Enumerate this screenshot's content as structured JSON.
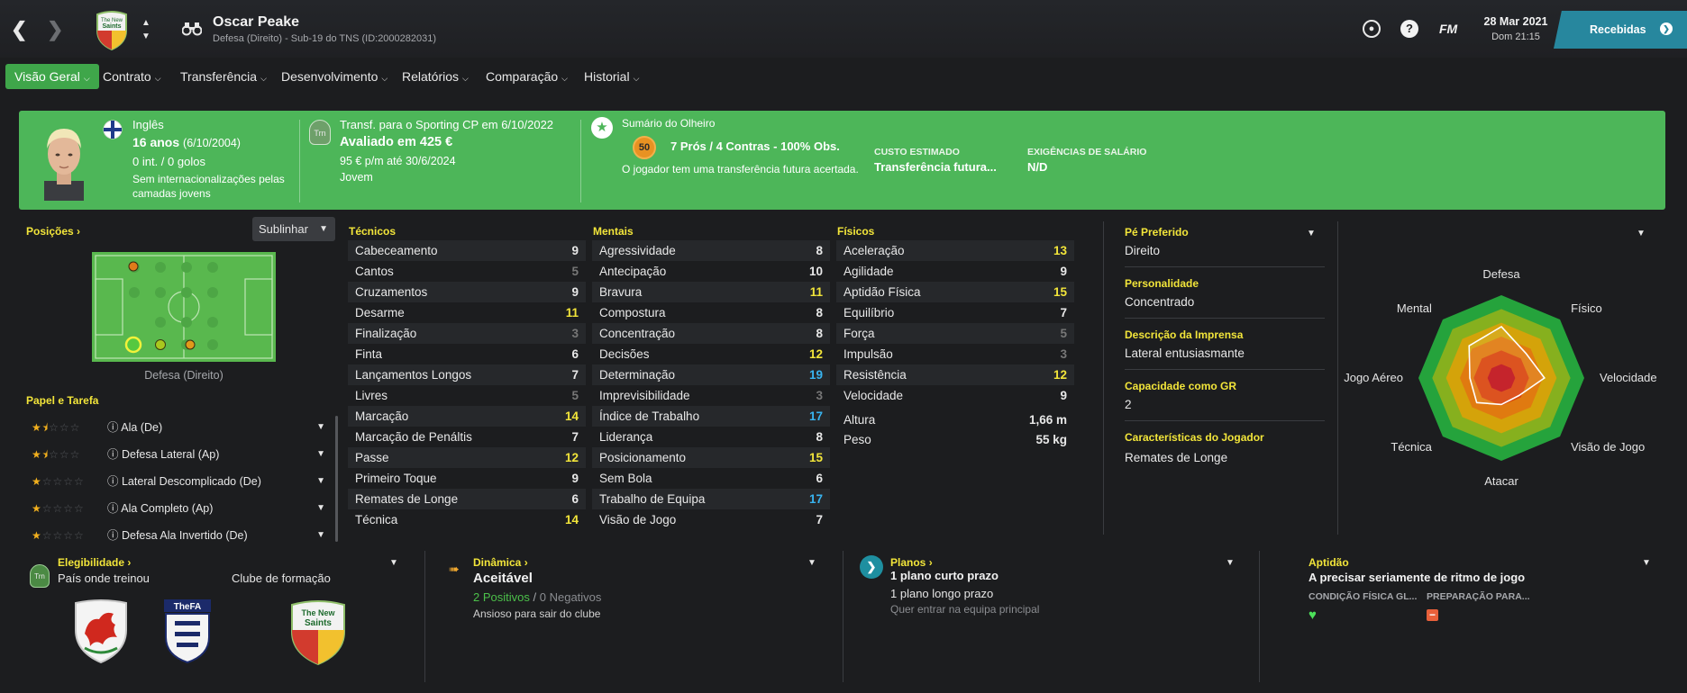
{
  "header": {
    "player_name": "Oscar Peake",
    "subtitle": "Defesa (Direito) - Sub-19 do TNS (ID:2000282031)",
    "date": "28 Mar 2021",
    "day_time": "Dom 21:15",
    "inbox_label": "Recebidas",
    "fm_label": "FM"
  },
  "nav": {
    "tabs": [
      "Visão Geral",
      "Contrato",
      "Transferência",
      "Desenvolvimento",
      "Relatórios",
      "Comparação",
      "Historial"
    ]
  },
  "banner": {
    "nationality": "Inglês",
    "age": "16 anos",
    "dob": "(6/10/2004)",
    "caps": "0 int. / 0 golos",
    "intl_note": "Sem internacionalizações pelas camadas jovens",
    "transfer": "Transf. para o Sporting CP em 6/10/2022",
    "value": "Avaliado em 425 €",
    "wage": "95 € p/m até 30/6/2024",
    "contract_type": "Jovem",
    "trn_badge": "Trn",
    "scout_title": "Sumário do Olheiro",
    "scout_score": "50",
    "scout_summary": "7 Prós / 4 Contras - 100% Obs.",
    "future_note": "O jogador tem uma transferência futura acertada.",
    "cost_label": "CUSTO ESTIMADO",
    "cost_value": "Transferência futura...",
    "salary_label": "EXIGÊNCIAS DE SALÁRIO",
    "salary_value": "N/D"
  },
  "positions": {
    "title": "Posições",
    "highlight_label": "Sublinhar",
    "position_label": "Defesa (Direito)"
  },
  "roles": {
    "title": "Papel e Tarefa",
    "items": [
      {
        "name": "Ala (De)",
        "stars": 1.5
      },
      {
        "name": "Defesa Lateral (Ap)",
        "stars": 1.5
      },
      {
        "name": "Lateral Descomplicado (De)",
        "stars": 1
      },
      {
        "name": "Ala Completo (Ap)",
        "stars": 1
      },
      {
        "name": "Defesa Ala Invertido (De)",
        "stars": 1
      }
    ]
  },
  "technical": {
    "title": "Técnicos",
    "items": [
      {
        "name": "Cabeceamento",
        "value": "9"
      },
      {
        "name": "Cantos",
        "value": "5"
      },
      {
        "name": "Cruzamentos",
        "value": "9"
      },
      {
        "name": "Desarme",
        "value": "11"
      },
      {
        "name": "Finalização",
        "value": "3"
      },
      {
        "name": "Finta",
        "value": "6"
      },
      {
        "name": "Lançamentos Longos",
        "value": "7"
      },
      {
        "name": "Livres",
        "value": "5"
      },
      {
        "name": "Marcação",
        "value": "14"
      },
      {
        "name": "Marcação de Penáltis",
        "value": "7"
      },
      {
        "name": "Passe",
        "value": "12"
      },
      {
        "name": "Primeiro Toque",
        "value": "9"
      },
      {
        "name": "Remates de Longe",
        "value": "6"
      },
      {
        "name": "Técnica",
        "value": "14"
      }
    ]
  },
  "mental": {
    "title": "Mentais",
    "items": [
      {
        "name": "Agressividade",
        "value": "8"
      },
      {
        "name": "Antecipação",
        "value": "10"
      },
      {
        "name": "Bravura",
        "value": "11"
      },
      {
        "name": "Compostura",
        "value": "8"
      },
      {
        "name": "Concentração",
        "value": "8"
      },
      {
        "name": "Decisões",
        "value": "12"
      },
      {
        "name": "Determinação",
        "value": "19"
      },
      {
        "name": "Imprevisibilidade",
        "value": "3"
      },
      {
        "name": "Índice de Trabalho",
        "value": "17"
      },
      {
        "name": "Liderança",
        "value": "8"
      },
      {
        "name": "Posicionamento",
        "value": "15"
      },
      {
        "name": "Sem Bola",
        "value": "6"
      },
      {
        "name": "Trabalho de Equipa",
        "value": "17"
      },
      {
        "name": "Visão de Jogo",
        "value": "7"
      }
    ]
  },
  "physical": {
    "title": "Físicos",
    "items": [
      {
        "name": "Aceleração",
        "value": "13"
      },
      {
        "name": "Agilidade",
        "value": "9"
      },
      {
        "name": "Aptidão Física",
        "value": "15"
      },
      {
        "name": "Equilíbrio",
        "value": "7"
      },
      {
        "name": "Força",
        "value": "5"
      },
      {
        "name": "Impulsão",
        "value": "3"
      },
      {
        "name": "Resistência",
        "value": "12"
      },
      {
        "name": "Velocidade",
        "value": "9"
      }
    ],
    "height_label": "Altura",
    "height": "1,66 m",
    "weight_label": "Peso",
    "weight": "55 kg"
  },
  "info": {
    "foot_label": "Pé Preferido",
    "foot": "Direito",
    "personality_label": "Personalidade",
    "personality": "Concentrado",
    "press_label": "Descrição da Imprensa",
    "press": "Lateral entusiasmante",
    "gk_label": "Capacidade como GR",
    "gk": "2",
    "traits_label": "Características do Jogador",
    "traits": "Remates de Longe"
  },
  "radar": {
    "labels": [
      "Defesa",
      "Físico",
      "Velocidade",
      "Visão de Jogo",
      "Atacar",
      "Técnica",
      "Jogo Aéreo",
      "Mental"
    ],
    "values": [
      0.62,
      0.42,
      0.52,
      0.3,
      0.32,
      0.42,
      0.38,
      0.55
    ],
    "colors": [
      "#25a33c",
      "#86b01e",
      "#d4a30a",
      "#e07a10",
      "#d9450e",
      "#c1121b"
    ]
  },
  "eligibility": {
    "title": "Elegibilidade",
    "trained_label": "País onde treinou",
    "club_label": "Clube de formação",
    "badge": "Trn",
    "fa_text": "TheFA",
    "club_text": "The New Saints"
  },
  "dynamics": {
    "title": "Dinâmica",
    "status": "Aceitável",
    "positives": "2 Positivos",
    "separator": "/",
    "negatives": "0 Negativos",
    "note": "Ansioso para sair do clube"
  },
  "plans": {
    "title": "Planos",
    "short": "1 plano curto prazo",
    "long": "1 plano longo prazo",
    "note": "Quer entrar na equipa principal"
  },
  "fitness": {
    "title": "Aptidão",
    "status": "A precisar seriamente de ritmo de jogo",
    "cond_label": "CONDIÇÃO FÍSICA GL...",
    "prep_label": "PREPARAÇÃO PARA..."
  }
}
